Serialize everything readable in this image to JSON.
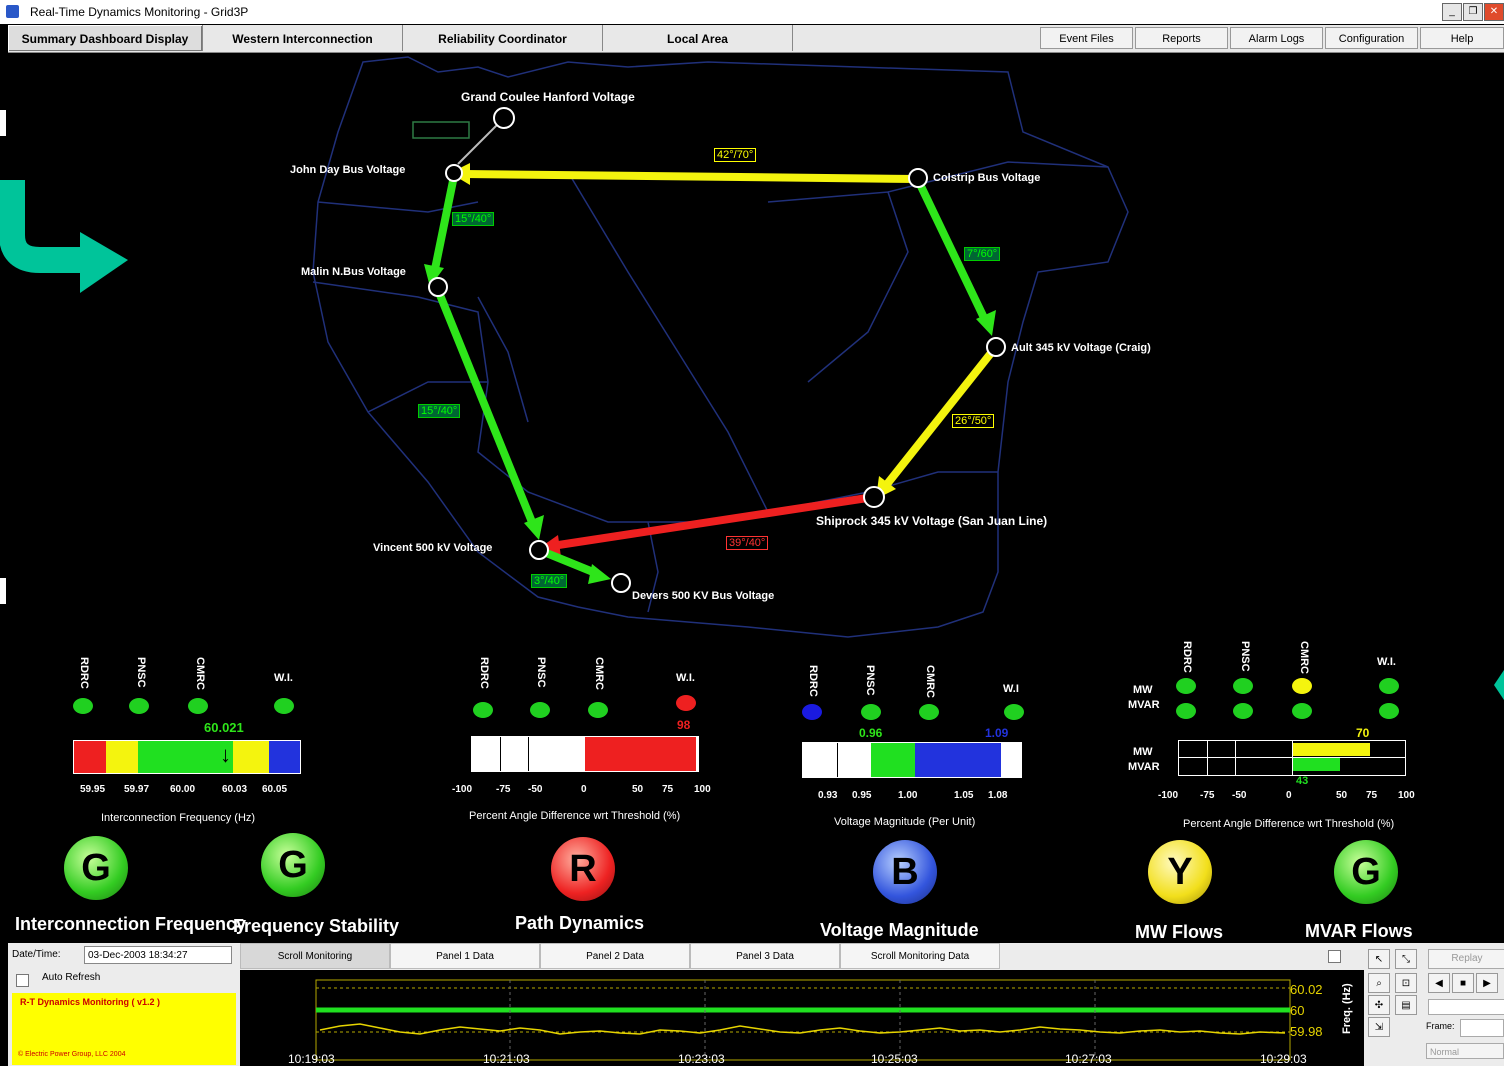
{
  "window": {
    "title": "Real-Time Dynamics Monitoring - Grid3P"
  },
  "menu": {
    "tabs": [
      "Summary Dashboard Display",
      "Western Interconnection",
      "Reliability Coordinator",
      "Local Area"
    ],
    "buttons": [
      "Event Files",
      "Reports",
      "Alarm Logs",
      "Configuration",
      "Help"
    ]
  },
  "map": {
    "voltages": {
      "grand_coulee": "Grand Coulee Hanford Voltage",
      "john_day": "John Day Bus Voltage",
      "colstrip": "Colstrip Bus Voltage",
      "malin": "Malin N.Bus Voltage",
      "ault": "Ault 345 kV Voltage (Craig)",
      "shiprock": "Shiprock 345 kV Voltage (San Juan Line)",
      "vincent": "Vincent 500 kV Voltage",
      "devers": "Devers 500 KV Bus Voltage"
    },
    "paths": {
      "colstrip_john_day": "42°/70°",
      "john_day_malin": "15°/40°",
      "colstrip_ault": "7°/60°",
      "malin_vincent": "15°/40°",
      "ault_shiprock": "26°/50°",
      "shiprock_vincent": "39°/40°",
      "vincent_devers": "3°/40°"
    },
    "colors": {
      "green": "#2ee51a",
      "yellow": "#f4f40e",
      "red": "#ee2020"
    }
  },
  "panels": {
    "frequency": {
      "labels": [
        "RDRC",
        "PNSC",
        "CMRC",
        "W.I."
      ],
      "value": "60.021",
      "scale": [
        "59.95",
        "59.97",
        "60.00",
        "60.03",
        "60.05"
      ],
      "caption": "Interconnection Frequency (Hz)"
    },
    "angle": {
      "labels": [
        "RDRC",
        "PNSC",
        "CMRC",
        "W.I."
      ],
      "value": "98",
      "scale": [
        "-100",
        "-75",
        "-50",
        "0",
        "50",
        "75",
        "100"
      ],
      "caption": "Percent Angle Difference wrt Threshold (%)"
    },
    "voltage": {
      "labels": [
        "RDRC",
        "PNSC",
        "CMRC",
        "W.I"
      ],
      "left_value": "0.96",
      "right_value": "1.09",
      "scale": [
        "0.93",
        "0.95",
        "1.00",
        "1.05",
        "1.08"
      ],
      "caption": "Voltage Magnitude (Per Unit)"
    },
    "flows": {
      "labels": [
        "RDRC",
        "PNSC",
        "CMRC",
        "W.I."
      ],
      "row_labels": [
        "MW",
        "MVAR"
      ],
      "mw_value": "70",
      "mvar_value": "43",
      "scale": [
        "-100",
        "-75",
        "-50",
        "0",
        "50",
        "75",
        "100"
      ],
      "caption": "Percent Angle Difference wrt Threshold (%)"
    }
  },
  "indicators": [
    {
      "letter": "G",
      "caption": "Interconnection Frequency",
      "color": "#33cc22"
    },
    {
      "letter": "G",
      "caption": "Frequency Stability",
      "color": "#33cc22"
    },
    {
      "letter": "R",
      "caption": "Path Dynamics",
      "color": "#ee2222"
    },
    {
      "letter": "B",
      "caption": "Voltage Magnitude",
      "color": "#3355dd"
    },
    {
      "letter": "Y",
      "caption": "MW Flows",
      "color": "#f2df1b"
    },
    {
      "letter": "G",
      "caption": "MVAR Flows",
      "color": "#33cc22"
    }
  ],
  "bottom": {
    "date_label": "Date/Time:",
    "date_value": "03-Dec-2003 18:34:27",
    "auto_refresh": "Auto Refresh",
    "app_version": "R-T Dynamics Monitoring ( v1.2 )",
    "copyright": "© Electric Power Group, LLC 2004",
    "tabs": [
      "Scroll Monitoring",
      "Panel 1 Data",
      "Panel 2 Data",
      "Panel 3 Data",
      "Scroll Monitoring Data"
    ],
    "times": [
      "10:19:03",
      "10:21:03",
      "10:23:03",
      "10:25:03",
      "10:27:03",
      "10:29:03"
    ],
    "y_labels": [
      "60.02",
      "60",
      "59.98"
    ],
    "axis_label": "Freq. (Hz)",
    "replay": "Replay",
    "frame_label": "Frame:",
    "normal": "Normal"
  }
}
